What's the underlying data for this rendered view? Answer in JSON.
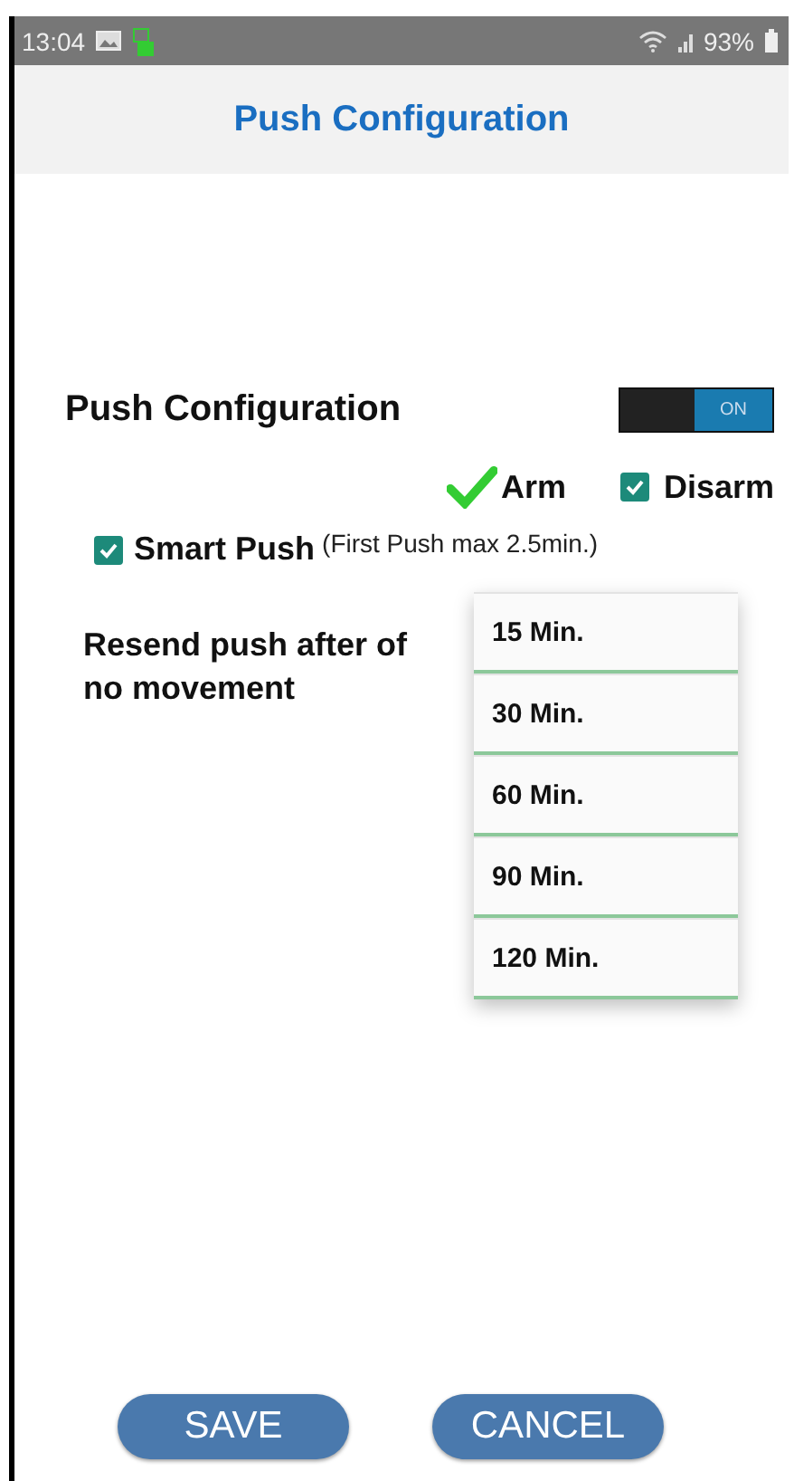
{
  "status_bar": {
    "time": "13:04",
    "battery": "93%"
  },
  "header": {
    "title": "Push Configuration"
  },
  "push": {
    "label": "Push Configuration",
    "on": true,
    "switch_text": "ON"
  },
  "options": [
    {
      "label": "Arm",
      "checked": true,
      "kind": "tick"
    },
    {
      "label": "Disarm",
      "checked": true,
      "kind": "checkbox"
    }
  ],
  "smart_push": {
    "label": "Smart Push",
    "note": "(First Push max 2.5min.)",
    "checked": true
  },
  "resend": {
    "label": "Resend push after of no movement"
  },
  "dropdown": [
    "15 Min.",
    "30 Min.",
    "60 Min.",
    "90 Min.",
    "120 Min."
  ],
  "buttons": [
    "SAVE",
    "CANCEL"
  ]
}
